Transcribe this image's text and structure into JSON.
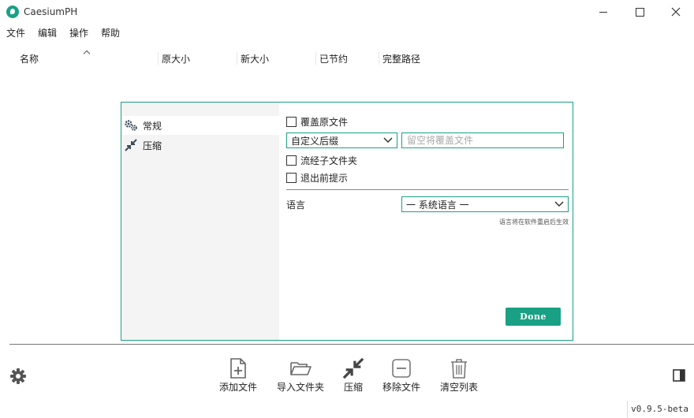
{
  "window": {
    "title": "CaesiumPH"
  },
  "menu": [
    "文件",
    "编辑",
    "操作",
    "帮助"
  ],
  "columns": [
    "名称",
    "原大小",
    "新大小",
    "已节约",
    "完整路径"
  ],
  "dialog": {
    "nav": [
      {
        "label": "常规",
        "icon": "gears-icon",
        "active": true
      },
      {
        "label": "压缩",
        "icon": "compress-icon",
        "active": false
      }
    ],
    "overwrite_label": "覆盖原文件",
    "suffix_select": "自定义后缀",
    "suffix_placeholder": "留空将覆盖文件",
    "subfolders_label": "流经子文件夹",
    "prompt_exit_label": "退出前提示",
    "language_label": "语言",
    "language_select": "一 系统语言 一",
    "language_hint": "语言将在软件重启后生效",
    "done_label": "Done"
  },
  "toolbar": [
    {
      "label": "添加文件",
      "icon": "add-file-icon"
    },
    {
      "label": "导入文件夹",
      "icon": "folder-open-icon"
    },
    {
      "label": "压缩",
      "icon": "compress-icon"
    },
    {
      "label": "移除文件",
      "icon": "remove-icon"
    },
    {
      "label": "清空列表",
      "icon": "trash-icon"
    }
  ],
  "version": "v0.9.5-beta",
  "colors": {
    "accent": "#1aa085"
  }
}
